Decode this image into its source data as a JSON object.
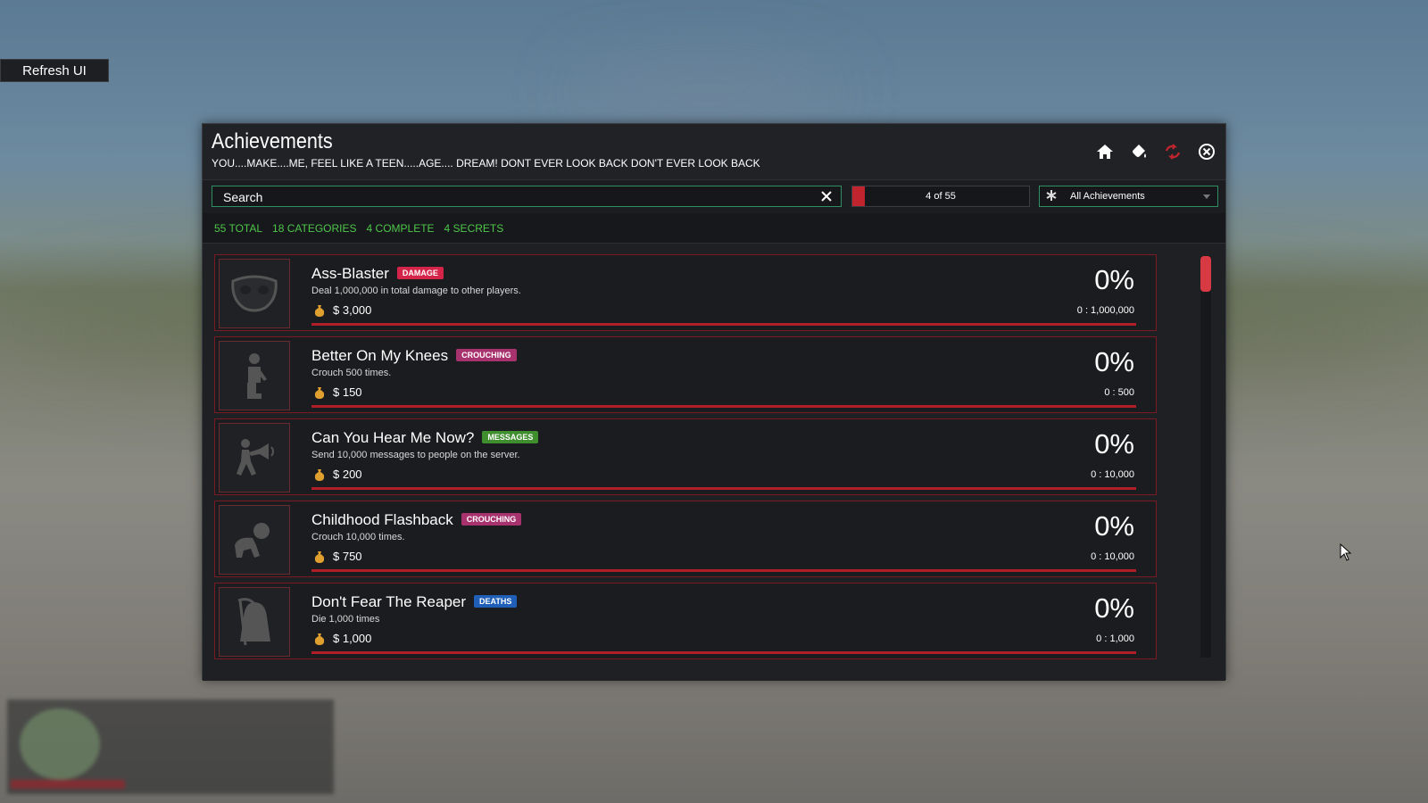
{
  "refresh_button": "Refresh UI",
  "window": {
    "title": "Achievements",
    "subtitle": "YOU....MAKE....ME, FEEL LIKE A TEEN.....AGE.... DREAM! DONT EVER LOOK BACK DON'T EVER LOOK BACK"
  },
  "header_icons": [
    "home-icon",
    "paint-bucket-icon",
    "refresh-icon",
    "close-icon"
  ],
  "search": {
    "placeholder": "Search"
  },
  "pager": {
    "text": "4 of 55",
    "progress": 0.0727
  },
  "filter": {
    "selected": "All Achievements"
  },
  "stats": {
    "total": "55 TOTAL",
    "categories": "18 CATEGORIES",
    "complete": "4 COMPLETE",
    "secrets": "4 SECRETS"
  },
  "achievements": [
    {
      "name": "Ass-Blaster",
      "tag": "DAMAGE",
      "tag_color": "#d4244a",
      "description": "Deal 1,000,000 in total damage to other players.",
      "reward": "$ 3,000",
      "percent": "0%",
      "progress": "0 : 1,000,000",
      "icon": "mask-icon"
    },
    {
      "name": "Better On My Knees",
      "tag": "CROUCHING",
      "tag_color": "#a8326e",
      "description": "Crouch 500 times.",
      "reward": "$ 150",
      "percent": "0%",
      "progress": "0 : 500",
      "icon": "kneeling-person-icon"
    },
    {
      "name": "Can You Hear Me Now?",
      "tag": "MESSAGES",
      "tag_color": "#3f8f2f",
      "description": "Send 10,000 messages to people on the server.",
      "reward": "$ 200",
      "percent": "0%",
      "progress": "0 : 10,000",
      "icon": "megaphone-person-icon"
    },
    {
      "name": "Childhood Flashback",
      "tag": "CROUCHING",
      "tag_color": "#a8326e",
      "description": "Crouch 10,000 times.",
      "reward": "$ 750",
      "percent": "0%",
      "progress": "0 : 10,000",
      "icon": "crawling-baby-icon"
    },
    {
      "name": "Don't Fear The Reaper",
      "tag": "DEATHS",
      "tag_color": "#1f5fb8",
      "description": "Die 1,000 times",
      "reward": "$ 1,000",
      "percent": "0%",
      "progress": "0 : 1,000",
      "icon": "reaper-icon"
    }
  ],
  "colors": {
    "accent_red": "#c0252f",
    "accent_green": "#4fc64a",
    "card_border": "#7a1a22"
  }
}
